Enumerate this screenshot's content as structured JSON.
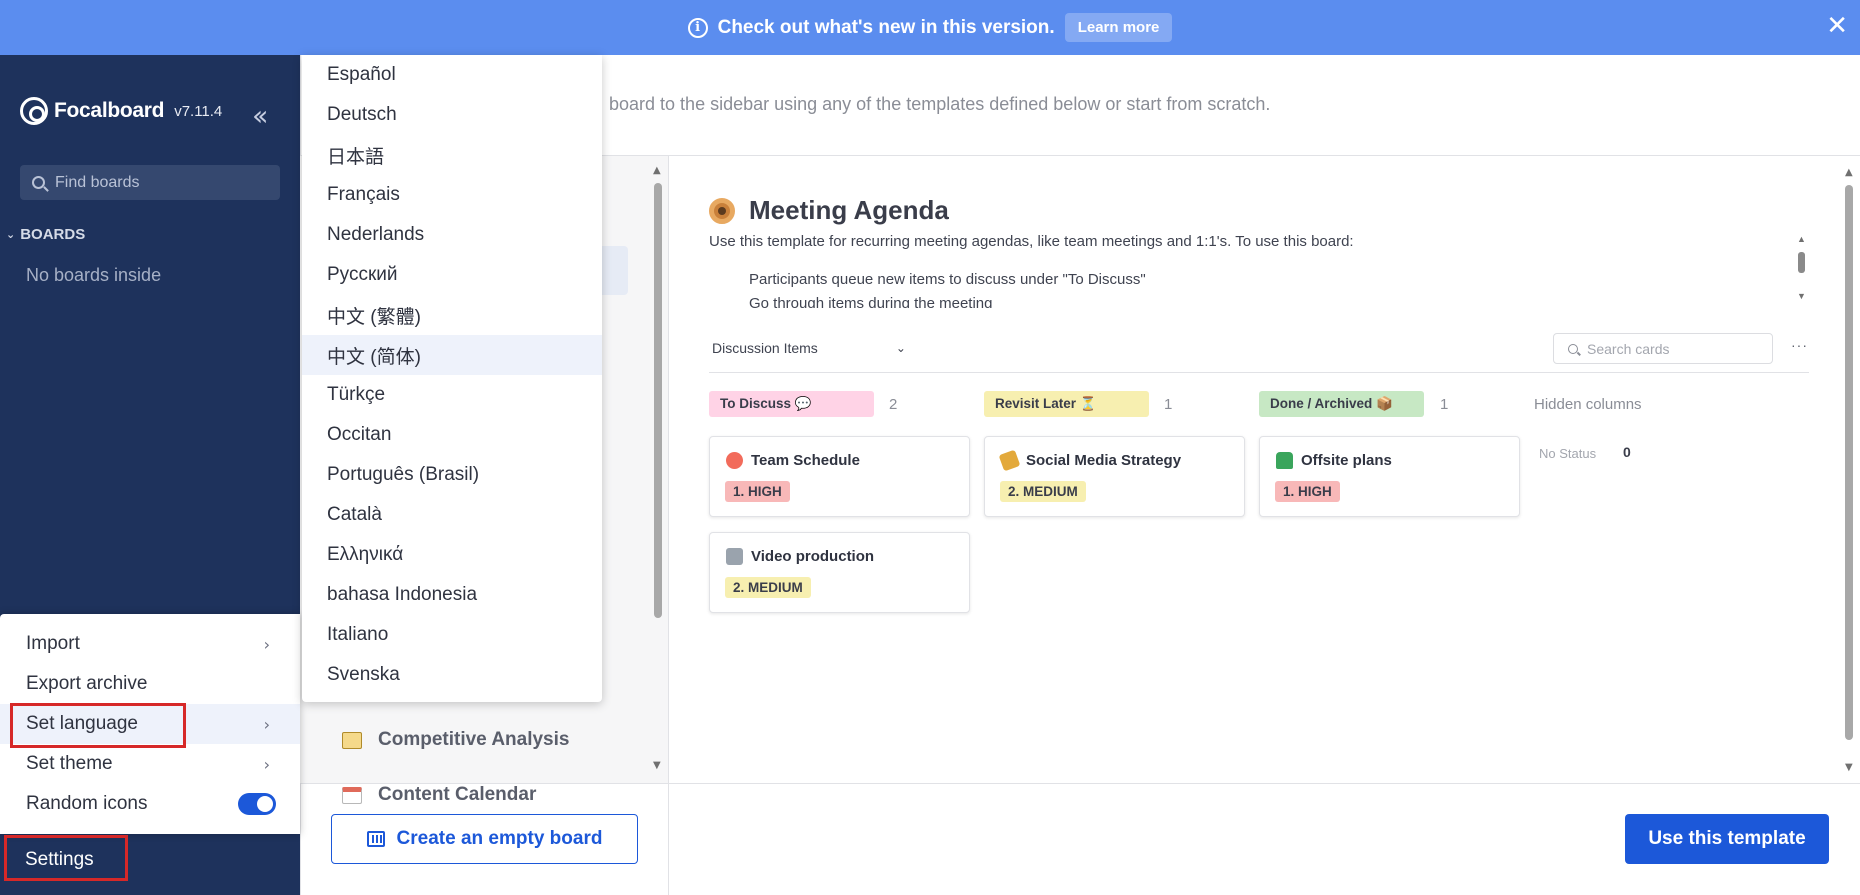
{
  "banner": {
    "text": "Check out what's new in this version.",
    "learn_more": "Learn more"
  },
  "sidebar": {
    "app_name": "Focalboard",
    "version": "v7.11.4",
    "search_placeholder": "Find boards",
    "boards_header": "BOARDS",
    "empty_text": "No boards inside"
  },
  "settings_menu": {
    "items": [
      {
        "label": "Import",
        "has_submenu": true
      },
      {
        "label": "Export archive",
        "has_submenu": false
      },
      {
        "label": "Set language",
        "has_submenu": true,
        "active": true
      },
      {
        "label": "Set theme",
        "has_submenu": true
      },
      {
        "label": "Random icons",
        "toggle": true,
        "toggle_on": true
      }
    ],
    "settings_label": "Settings"
  },
  "languages": [
    "Español",
    "Deutsch",
    "日本語",
    "Français",
    "Nederlands",
    "Русский",
    "中文 (繁體)",
    "中文 (简体)",
    "Türkçe",
    "Occitan",
    "Português (Brasil)",
    "Català",
    "Ελληνικά",
    "bahasa Indonesia",
    "Italiano",
    "Svenska"
  ],
  "selected_language": "中文 (简体)",
  "main": {
    "description": "board to the sidebar using any of the templates defined below or start from scratch.",
    "templates": [
      {
        "label": "Competitive Analysis",
        "icon": "folder-icon"
      },
      {
        "label": "Content Calendar",
        "icon": "calendar-icon"
      }
    ],
    "create_empty_label": "Create an empty board",
    "use_template_label": "Use this template"
  },
  "preview": {
    "title": "Meeting Agenda",
    "description": "Use this template for recurring meeting agendas, like team meetings and 1:1's. To use this board:",
    "bullets": [
      "Participants queue new items to discuss under \"To Discuss\"",
      "Go through items during the meeting"
    ],
    "view_name": "Discussion Items",
    "search_placeholder": "Search cards",
    "more": "···",
    "columns": [
      {
        "label": "To Discuss 💬",
        "count": "2",
        "color": "#ffd3e6"
      },
      {
        "label": "Revisit Later ⏳",
        "count": "1",
        "color": "#f7efb0"
      },
      {
        "label": "Done / Archived 📦",
        "count": "1",
        "color": "#c7e8c4"
      }
    ],
    "hidden_columns": "Hidden columns",
    "no_status": "No Status",
    "no_status_count": "0",
    "cards": [
      {
        "title": "Team Schedule",
        "tag": "1. HIGH",
        "emoji": "alarm-clock-icon"
      },
      {
        "title": "Social Media Strategy",
        "tag": "2. MEDIUM",
        "emoji": "megaphone-icon"
      },
      {
        "title": "Offsite plans",
        "tag": "1. HIGH",
        "emoji": "car-icon"
      },
      {
        "title": "Video production",
        "tag": "2. MEDIUM",
        "emoji": "video-icon"
      }
    ],
    "tag_colors": {
      "high": "#f8b8b8",
      "medium": "#f7efb0"
    }
  }
}
